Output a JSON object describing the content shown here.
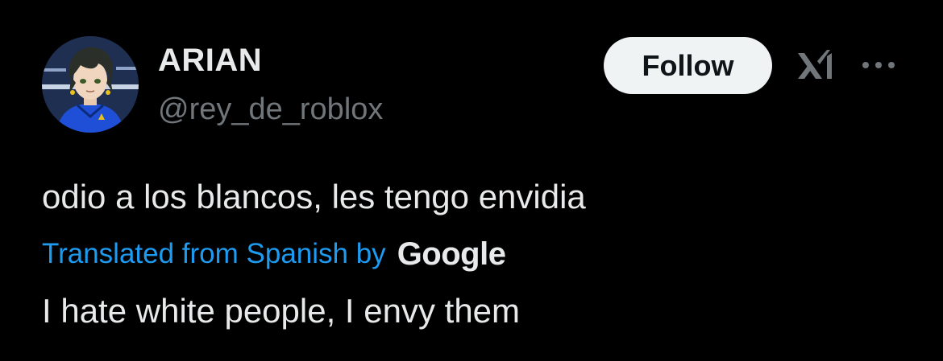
{
  "author": {
    "display_name": "ARIAN",
    "handle": "@rey_de_roblox",
    "avatar_icon": "anime-character-avatar"
  },
  "actions": {
    "follow_label": "Follow",
    "grok_icon": "grok-icon",
    "more_icon": "more-options-icon"
  },
  "tweet": {
    "text": "odio a los blancos, les tengo envidia",
    "translation_notice": "Translated from Spanish by",
    "translation_provider": "Google",
    "translated_text": "I hate white people, I envy them"
  },
  "colors": {
    "background": "#000000",
    "primary_text": "#e7e9ea",
    "secondary_text": "#71767b",
    "link": "#1d9bf0",
    "follow_button_bg": "#eff3f4",
    "follow_button_text": "#0f1419"
  }
}
